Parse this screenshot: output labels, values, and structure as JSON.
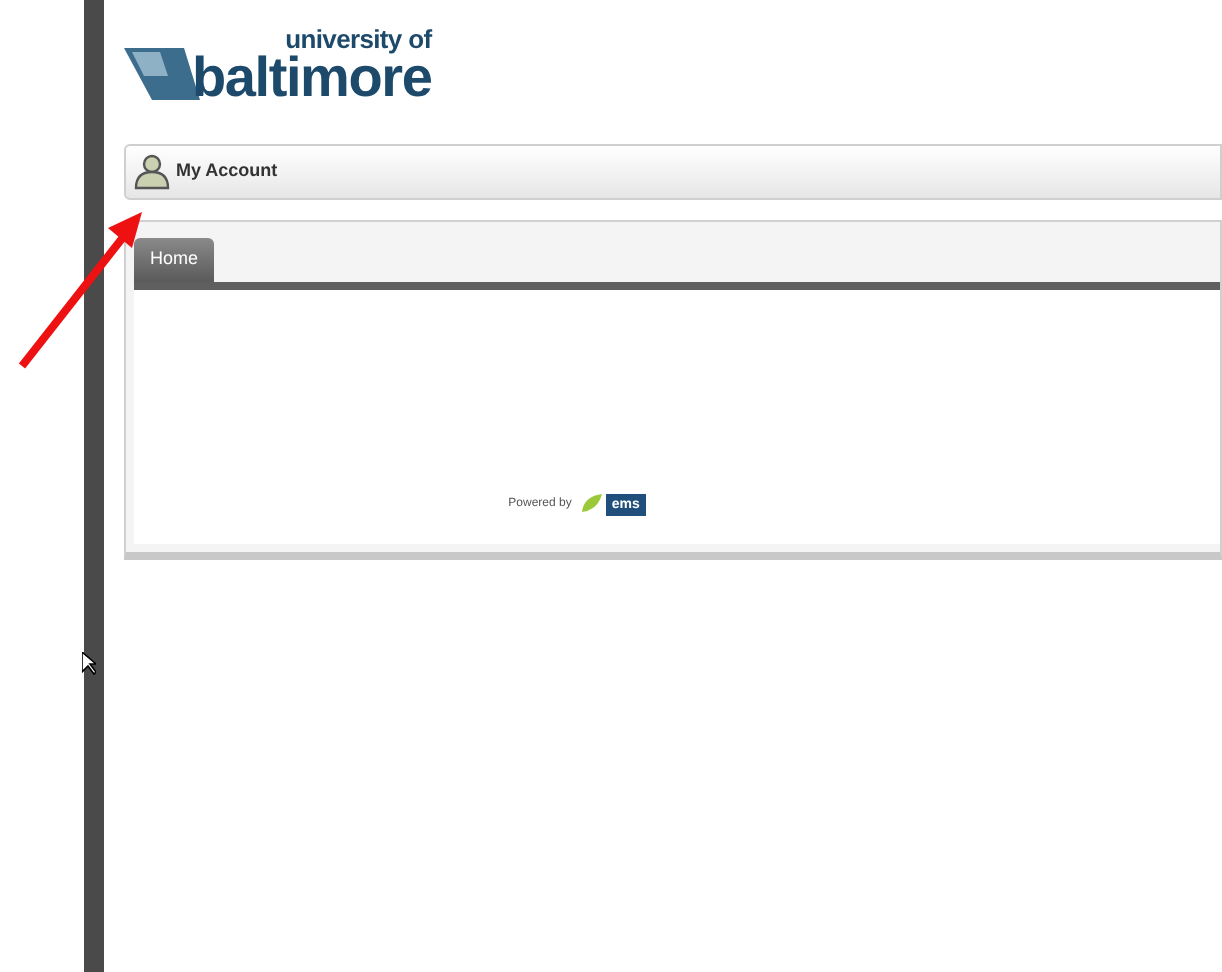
{
  "logo": {
    "small": "university of",
    "large": "baltimore"
  },
  "account_bar": {
    "label": "My Account"
  },
  "tabs": [
    {
      "label": "Home",
      "selected": true
    }
  ],
  "footer": {
    "powered_by": "Powered by",
    "brand": "ems"
  }
}
